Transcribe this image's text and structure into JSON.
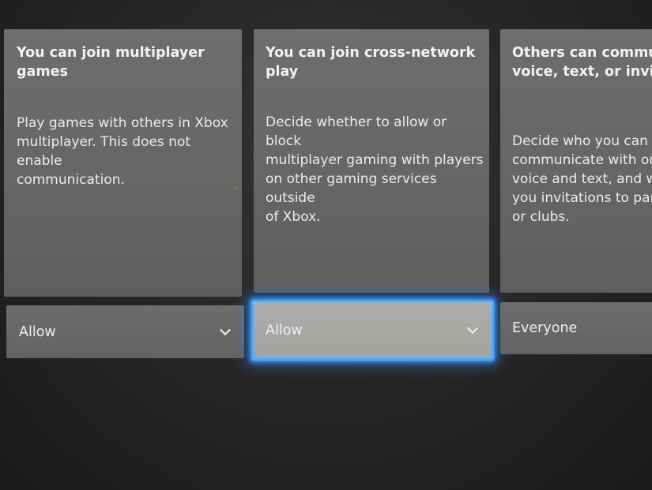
{
  "cards": [
    {
      "title": "You can join multiplayer games",
      "description": "Play games with others in Xbox\nmultiplayer. This does not enable\ncommunication.",
      "dropdown_value": "Allow"
    },
    {
      "title": "You can join cross-network play",
      "description": "Decide whether to allow or block\nmultiplayer gaming with players\non other gaming services outside\nof Xbox.",
      "dropdown_value": "Allow"
    },
    {
      "title": "Others can communic\nvoice, text, or invites",
      "description": "Decide who you can\ncommunicate with on X\nvoice and text, and who\nyou invitations to partie\nor clubs.",
      "dropdown_value": "Everyone"
    }
  ],
  "icons": {
    "dropdown": "chevron-down-icon"
  },
  "colors": {
    "focus_ring": "#4aa8ff",
    "card_bg": "#686866",
    "background": "#262524"
  }
}
